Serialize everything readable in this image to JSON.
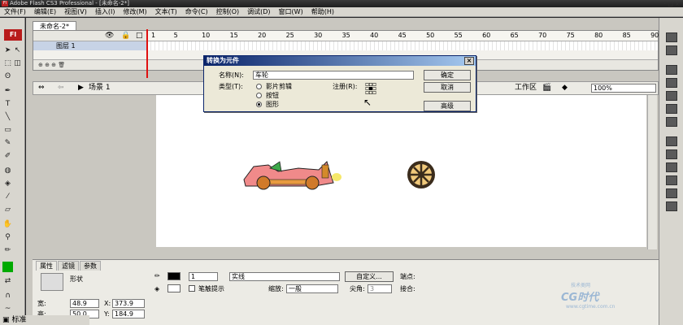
{
  "window": {
    "title": "Adobe Flash CS3 Professional - [未命名-2*]",
    "controls": "- □ ×"
  },
  "menu": [
    "文件(F)",
    "编辑(E)",
    "视图(V)",
    "插入(I)",
    "修改(M)",
    "文本(T)",
    "命令(C)",
    "控制(O)",
    "调试(D)",
    "窗口(W)",
    "帮助(H)"
  ],
  "app_logo": "Fl",
  "doc_tab": "未命名-2*",
  "timeline": {
    "layer_name": "图层 1",
    "ruler": [
      "1",
      "5",
      "10",
      "15",
      "20",
      "25",
      "30",
      "35",
      "40",
      "45",
      "50",
      "55",
      "60",
      "65",
      "70",
      "75",
      "80",
      "85",
      "90"
    ]
  },
  "editbar": {
    "scene": "场景 1",
    "workspace": "工作区",
    "zoom": "100%"
  },
  "dialog": {
    "title": "转换为元件",
    "name_label": "名称(N):",
    "name_value": "车轮",
    "type_label": "类型(T):",
    "types": [
      "影片剪辑",
      "按钮",
      "图形"
    ],
    "selected_type": "图形",
    "reg_label": "注册(R):",
    "ok": "确定",
    "cancel": "取消",
    "advanced": "高级"
  },
  "props": {
    "tabs": [
      "属性",
      "滤镜",
      "参数"
    ],
    "shape_label": "形状",
    "stroke_width": "1",
    "stroke_style": "实线",
    "custom_btn": "自定义...",
    "endpoint_label": "端点:",
    "hint_label": "笔触提示",
    "scale_label": "缩放:",
    "scale_value": "一般",
    "miter_label": "尖角:",
    "miter_value": "3",
    "join_label": "接合:",
    "w_label": "宽:",
    "w_value": "48.9",
    "h_label": "高:",
    "h_value": "50.0",
    "x_label": "X:",
    "x_value": "373.9",
    "y_label": "Y:",
    "y_value": "184.9"
  },
  "watermark": {
    "text": "CG时代",
    "sub": "www.cgtime.com.cn",
    "top": "技术类网"
  },
  "taskbar": "标准",
  "colors": {
    "accent_red": "#b81b1b",
    "dialog_blue": "#0a246a",
    "panel": "#ecebe5"
  }
}
